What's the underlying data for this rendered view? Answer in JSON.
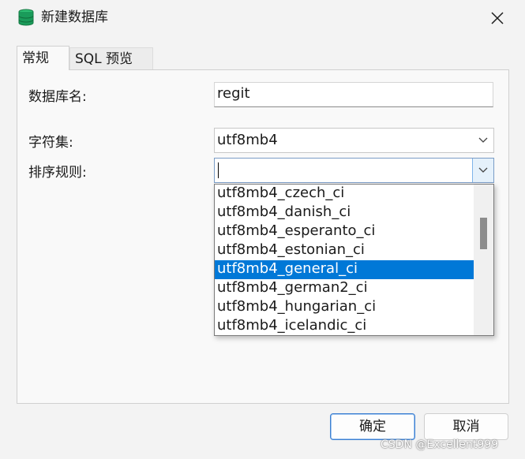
{
  "window": {
    "title": "新建数据库",
    "icon": "database-icon",
    "close_icon": "close-icon"
  },
  "tabs": [
    {
      "label": "常规",
      "active": true
    },
    {
      "label": "SQL 预览",
      "active": false
    }
  ],
  "form": {
    "db_name_label": "数据库名:",
    "db_name_value": "regit",
    "charset_label": "字符集:",
    "charset_value": "utf8mb4",
    "collation_label": "排序规则:",
    "collation_value": ""
  },
  "collation_options": [
    "utf8mb4_czech_ci",
    "utf8mb4_danish_ci",
    "utf8mb4_esperanto_ci",
    "utf8mb4_estonian_ci",
    "utf8mb4_general_ci",
    "utf8mb4_german2_ci",
    "utf8mb4_hungarian_ci",
    "utf8mb4_icelandic_ci"
  ],
  "selected_option": "utf8mb4_general_ci",
  "buttons": {
    "ok": "确定",
    "cancel": "取消"
  },
  "watermark": "CSDN @Excellent999",
  "colors": {
    "selection": "#0078d7",
    "db_icon": "#1a9b5a"
  }
}
